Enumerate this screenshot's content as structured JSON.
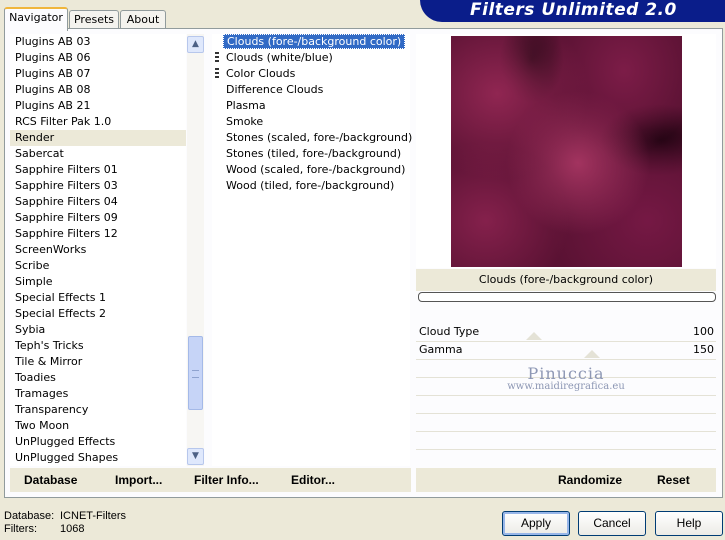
{
  "title": "Filters Unlimited 2.0",
  "tabs": [
    {
      "label": "Navigator",
      "active": true
    },
    {
      "label": "Presets",
      "active": false
    },
    {
      "label": "About",
      "active": false
    }
  ],
  "categories": [
    "Plugins AB 03",
    "Plugins AB 06",
    "Plugins AB 07",
    "Plugins AB 08",
    "Plugins AB 21",
    "RCS Filter Pak 1.0",
    "Render",
    "Sabercat",
    "Sapphire Filters 01",
    "Sapphire Filters 03",
    "Sapphire Filters 04",
    "Sapphire Filters 09",
    "Sapphire Filters 12",
    "ScreenWorks",
    "Scribe",
    "Simple",
    "Special Effects 1",
    "Special Effects 2",
    "Sybia",
    "Teph's Tricks",
    "Tile & Mirror",
    "Toadies",
    "Tramages",
    "Transparency",
    "Two Moon",
    "UnPlugged Effects",
    "UnPlugged Shapes"
  ],
  "selected_category": "Render",
  "filters": [
    {
      "label": "Clouds (fore-/background color)",
      "selected": true,
      "flag": false
    },
    {
      "label": "Clouds (white/blue)",
      "selected": false,
      "flag": true
    },
    {
      "label": "Color Clouds",
      "selected": false,
      "flag": true
    },
    {
      "label": "Difference Clouds",
      "selected": false,
      "flag": false
    },
    {
      "label": "Plasma",
      "selected": false,
      "flag": false
    },
    {
      "label": "Smoke",
      "selected": false,
      "flag": false
    },
    {
      "label": "Stones (scaled, fore-/background)",
      "selected": false,
      "flag": false
    },
    {
      "label": "Stones (tiled, fore-/background)",
      "selected": false,
      "flag": false
    },
    {
      "label": "Wood (scaled, fore-/background)",
      "selected": false,
      "flag": false
    },
    {
      "label": "Wood (tiled, fore-/background)",
      "selected": false,
      "flag": false
    }
  ],
  "preview_filter_name": "Clouds (fore-/background color)",
  "params": [
    {
      "name": "Cloud Type",
      "value": "100"
    },
    {
      "name": "Gamma",
      "value": "150"
    }
  ],
  "watermark": {
    "line1": "Pinuccia",
    "line2": "www.maidiregrafica.eu"
  },
  "toolbar": {
    "database": "Database",
    "import": "Import...",
    "filter_info": "Filter Info...",
    "editor": "Editor...",
    "randomize": "Randomize",
    "reset": "Reset"
  },
  "footer": {
    "database_label": "Database:",
    "database_value": "ICNET-Filters",
    "filters_label": "Filters:",
    "filters_value": "1068"
  },
  "buttons": {
    "apply": "Apply",
    "cancel": "Cancel",
    "help": "Help"
  },
  "colors": {
    "accent": "#316ac5",
    "banner": "#0a1d8a",
    "preview_base": "#5a1233"
  }
}
